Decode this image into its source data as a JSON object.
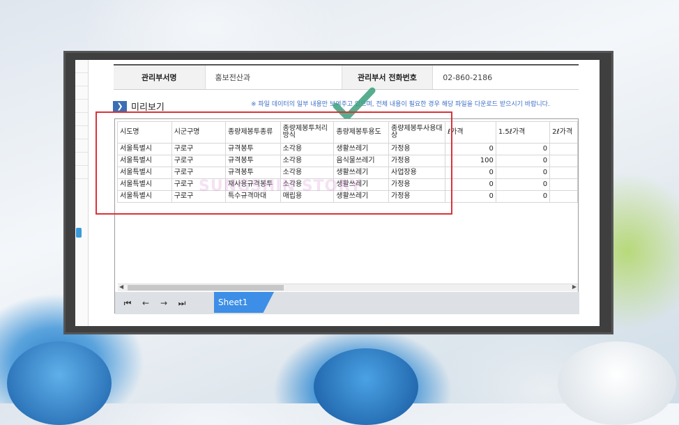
{
  "info": {
    "dept_label": "관리부서명",
    "dept_value": "홍보전산과",
    "phone_label": "관리부서 전화번호",
    "phone_value": "02-860-2186"
  },
  "preview": {
    "title": "미리보기",
    "notice": "※ 파일 데이터의 일부 내용만 보여주고 있으며, 전체 내용이 필요한 경우 해당 파일을 다운로드 받으시기 바랍니다."
  },
  "grid": {
    "columns": [
      "시도명",
      "시군구명",
      "종량제봉투종류",
      "종량제봉투처리방식",
      "종량제봉투용도",
      "종량제봉투사용대상",
      "ℓ가격",
      "1.5ℓ가격",
      "2ℓ가격"
    ],
    "rows": [
      [
        "서울특별시",
        "구로구",
        "규격봉투",
        "소각용",
        "생활쓰레기",
        "가정용",
        "0",
        "0",
        ""
      ],
      [
        "서울특별시",
        "구로구",
        "규격봉투",
        "소각용",
        "음식물쓰레기",
        "가정용",
        "100",
        "0",
        ""
      ],
      [
        "서울특별시",
        "구로구",
        "규격봉투",
        "소각용",
        "생활쓰레기",
        "사업장용",
        "0",
        "0",
        ""
      ],
      [
        "서울특별시",
        "구로구",
        "재사용규격봉투",
        "소각용",
        "생활쓰레기",
        "가정용",
        "0",
        "0",
        ""
      ],
      [
        "서울특별시",
        "구로구",
        "특수규격마대",
        "매립용",
        "생활쓰레기",
        "가정용",
        "0",
        "0",
        ""
      ]
    ],
    "watermark": "SUNGSHIN STORY"
  },
  "sheetbar": {
    "sheet_tab": "Sheet1",
    "first_icon": "first-page-icon",
    "prev_icon": "prev-icon",
    "next_icon": "next-icon",
    "last_icon": "last-page-icon"
  },
  "colors": {
    "highlight_box": "#d9323a",
    "checkmark": "#3aa07a",
    "sheet_tab": "#3d8ee6",
    "notice_text": "#3d6fc6"
  }
}
